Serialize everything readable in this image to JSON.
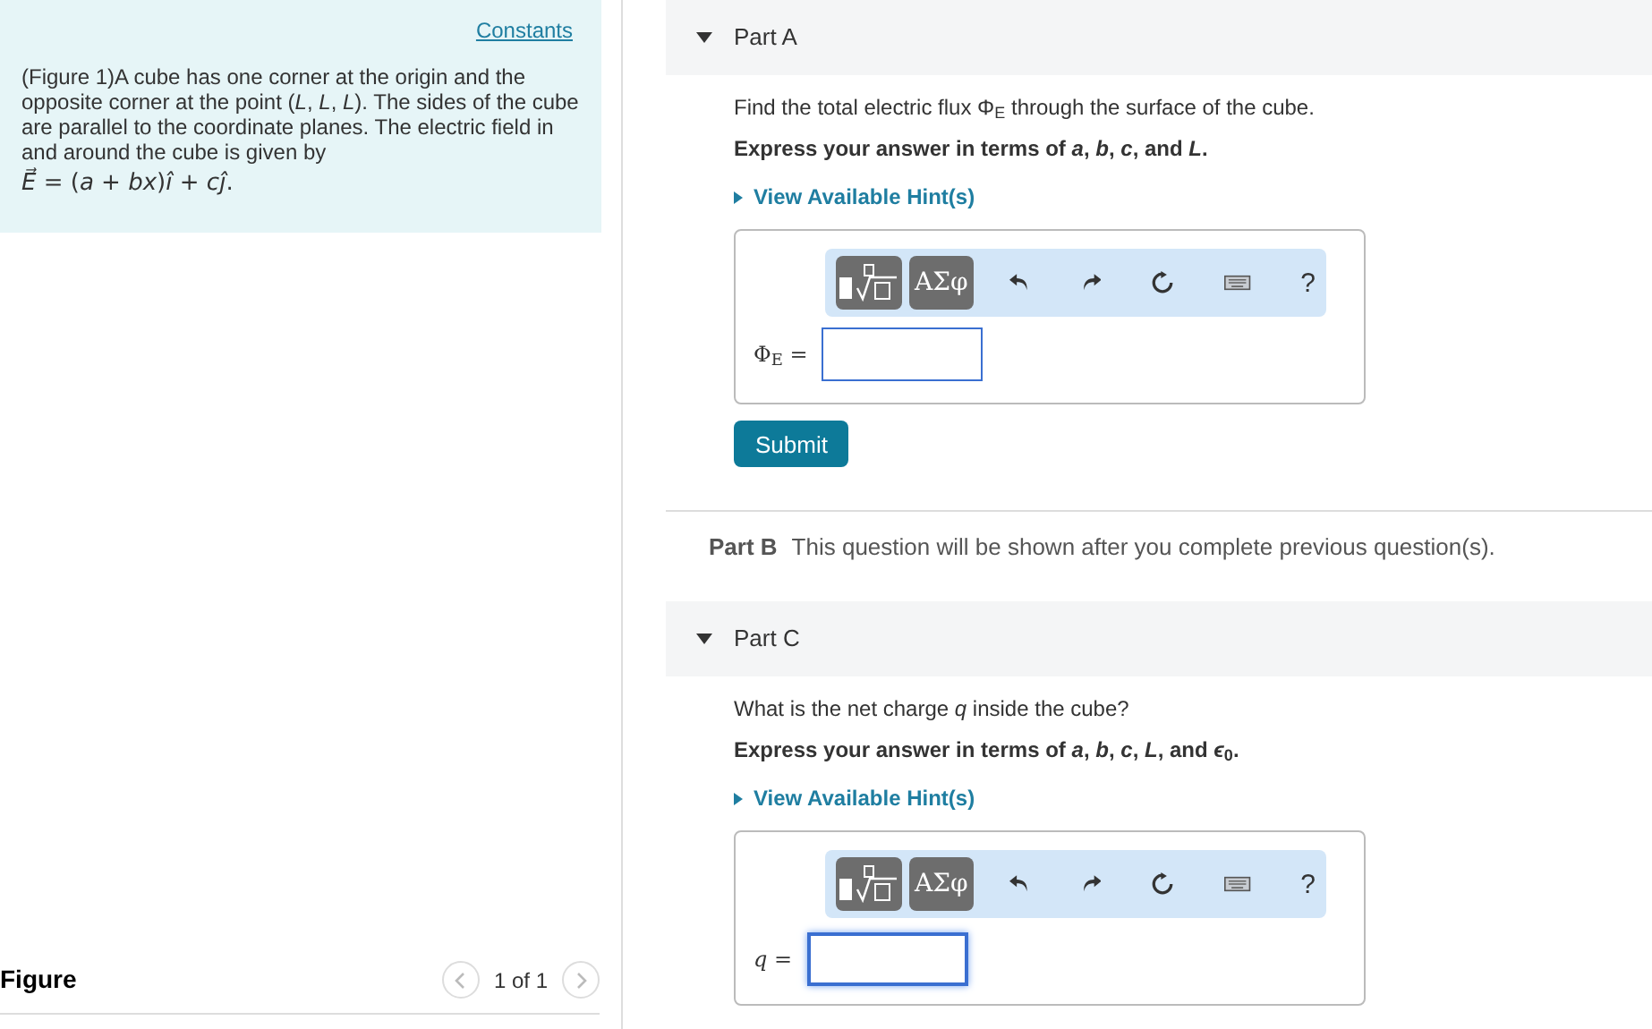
{
  "left": {
    "constants_link": "Constants",
    "intro": "(Figure 1)A cube has one corner at the origin and the opposite corner at the point (*L*, *L*, *L*). The sides of the cube are parallel to the coordinate planes. The electric field in and around the cube is given by",
    "formula": "*E⃗* = (*a* + *bx*)*î* + *cĵ*.",
    "figure": {
      "title": "Figure",
      "pager": "1 of 1",
      "prev_disabled": true,
      "next_disabled": true
    }
  },
  "parts": [
    {
      "kind": "open",
      "title": "Part A",
      "expanded": true,
      "question": "Find the total electric flux Φ$_{E}$ through the surface of the cube.",
      "instruction": "Express your answer in terms of *a*, *b*, *c*, and *L*.",
      "hint": "View Available Hint(s)",
      "greek": "ΑΣφ",
      "help": "?",
      "answer_label": "Φ$_{E}$ =",
      "focused": false,
      "submit": "Submit"
    },
    {
      "kind": "locked",
      "title": "Part B",
      "message": "This question will be shown after you complete previous question(s)."
    },
    {
      "kind": "open",
      "title": "Part C",
      "expanded": true,
      "question": "What is the net charge *q* inside the cube?",
      "instruction": "Express your answer in terms of *a*, *b*, *c*, *L*, and *ϵ*$_{0}$.",
      "hint": "View Available Hint(s)",
      "greek": "ΑΣφ",
      "help": "?",
      "answer_label": "*q* =",
      "focused": true
    }
  ]
}
